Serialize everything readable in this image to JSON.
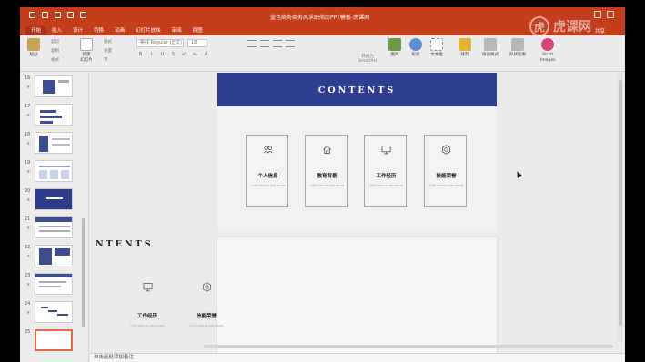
{
  "window": {
    "title": "蓝色商务商务风求职简历PPT模板-虎课网"
  },
  "watermark": {
    "mark": "虎",
    "text": "虎课网"
  },
  "ribbon": {
    "tabs": [
      "开始",
      "插入",
      "设计",
      "切换",
      "动画",
      "幻灯片放映",
      "审阅",
      "视图"
    ],
    "active_tab": "开始",
    "share_label": "共享",
    "clipboard": {
      "paste": "粘贴",
      "cut": "剪切",
      "copy": "复制",
      "format": "格式"
    },
    "slides_group": {
      "new_slide": "新建\n幻灯片",
      "layout": "版式",
      "reset": "重置",
      "section": "节"
    },
    "font_name": "等线 Regular (正文)",
    "font_size": "18",
    "smartart_label": "转换为\nSmartArt",
    "insert_buttons": [
      {
        "label": "图片",
        "color": "#6b9b4a"
      },
      {
        "label": "形状",
        "color": "#5f8fd1"
      },
      {
        "label": "文本框",
        "color": "#888888"
      },
      {
        "label": "排列",
        "color": "#e1b33a"
      },
      {
        "label": "快速样式",
        "color": "#b8b8b8"
      },
      {
        "label": "形状轮廓",
        "color": "#b8b8b8"
      },
      {
        "label": "Pickit\nImages",
        "color": "#d6457a"
      }
    ]
  },
  "thumbnails": [
    {
      "num": "16",
      "style": "light"
    },
    {
      "num": "17",
      "style": "light"
    },
    {
      "num": "18",
      "style": "light"
    },
    {
      "num": "19",
      "style": "light"
    },
    {
      "num": "20",
      "style": "dark"
    },
    {
      "num": "21",
      "style": "light"
    },
    {
      "num": "22",
      "style": "light"
    },
    {
      "num": "23",
      "style": "light"
    },
    {
      "num": "24",
      "style": "light"
    },
    {
      "num": "25",
      "style": "selected"
    }
  ],
  "slide": {
    "title": "CONTENTS",
    "cards": [
      {
        "icon": "people-icon",
        "title": "个人信息",
        "subtitle": "Click here to add words"
      },
      {
        "icon": "home-icon",
        "title": "教育背景",
        "subtitle": "Click here to add words"
      },
      {
        "icon": "monitor-icon",
        "title": "工作经历",
        "subtitle": "Click here to add words"
      },
      {
        "icon": "gear-icon",
        "title": "技能荣誉",
        "subtitle": "Click here to add words"
      }
    ]
  },
  "ghost": {
    "title": "NTENTS",
    "items": [
      {
        "icon": "monitor-icon",
        "title": "工作经历",
        "subtitle": "Click here to add words"
      },
      {
        "icon": "gear-icon",
        "title": "技能荣誉",
        "subtitle": "Click here to add words"
      }
    ]
  },
  "notes": {
    "placeholder": "单击此处添加备注"
  },
  "colors": {
    "ribbon": "#c43e1c",
    "slide_header": "#2e3f8f"
  }
}
